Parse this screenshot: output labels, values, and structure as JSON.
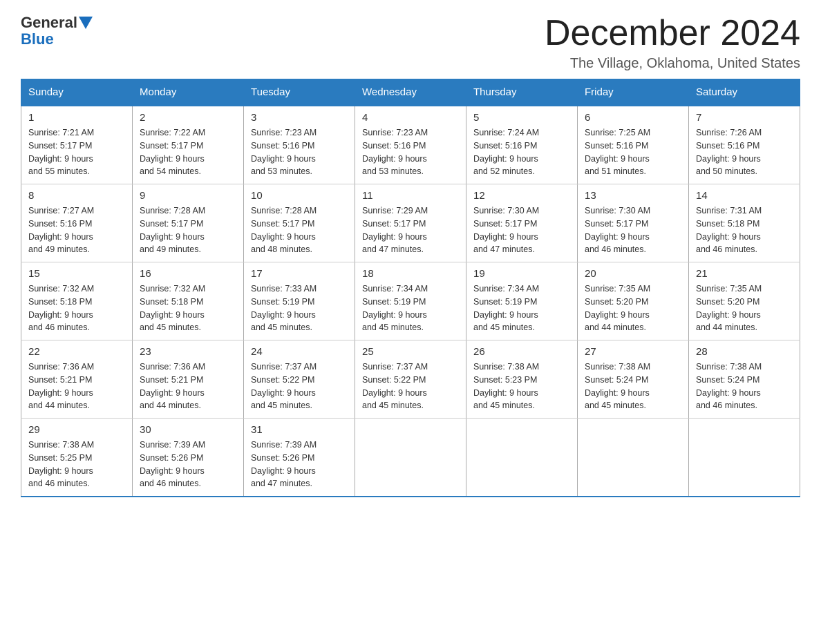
{
  "header": {
    "logo_general": "General",
    "logo_blue": "Blue",
    "month_title": "December 2024",
    "location": "The Village, Oklahoma, United States"
  },
  "columns": [
    "Sunday",
    "Monday",
    "Tuesday",
    "Wednesday",
    "Thursday",
    "Friday",
    "Saturday"
  ],
  "weeks": [
    [
      {
        "day": "1",
        "sunrise": "7:21 AM",
        "sunset": "5:17 PM",
        "daylight": "9 hours and 55 minutes."
      },
      {
        "day": "2",
        "sunrise": "7:22 AM",
        "sunset": "5:17 PM",
        "daylight": "9 hours and 54 minutes."
      },
      {
        "day": "3",
        "sunrise": "7:23 AM",
        "sunset": "5:16 PM",
        "daylight": "9 hours and 53 minutes."
      },
      {
        "day": "4",
        "sunrise": "7:23 AM",
        "sunset": "5:16 PM",
        "daylight": "9 hours and 53 minutes."
      },
      {
        "day": "5",
        "sunrise": "7:24 AM",
        "sunset": "5:16 PM",
        "daylight": "9 hours and 52 minutes."
      },
      {
        "day": "6",
        "sunrise": "7:25 AM",
        "sunset": "5:16 PM",
        "daylight": "9 hours and 51 minutes."
      },
      {
        "day": "7",
        "sunrise": "7:26 AM",
        "sunset": "5:16 PM",
        "daylight": "9 hours and 50 minutes."
      }
    ],
    [
      {
        "day": "8",
        "sunrise": "7:27 AM",
        "sunset": "5:16 PM",
        "daylight": "9 hours and 49 minutes."
      },
      {
        "day": "9",
        "sunrise": "7:28 AM",
        "sunset": "5:17 PM",
        "daylight": "9 hours and 49 minutes."
      },
      {
        "day": "10",
        "sunrise": "7:28 AM",
        "sunset": "5:17 PM",
        "daylight": "9 hours and 48 minutes."
      },
      {
        "day": "11",
        "sunrise": "7:29 AM",
        "sunset": "5:17 PM",
        "daylight": "9 hours and 47 minutes."
      },
      {
        "day": "12",
        "sunrise": "7:30 AM",
        "sunset": "5:17 PM",
        "daylight": "9 hours and 47 minutes."
      },
      {
        "day": "13",
        "sunrise": "7:30 AM",
        "sunset": "5:17 PM",
        "daylight": "9 hours and 46 minutes."
      },
      {
        "day": "14",
        "sunrise": "7:31 AM",
        "sunset": "5:18 PM",
        "daylight": "9 hours and 46 minutes."
      }
    ],
    [
      {
        "day": "15",
        "sunrise": "7:32 AM",
        "sunset": "5:18 PM",
        "daylight": "9 hours and 46 minutes."
      },
      {
        "day": "16",
        "sunrise": "7:32 AM",
        "sunset": "5:18 PM",
        "daylight": "9 hours and 45 minutes."
      },
      {
        "day": "17",
        "sunrise": "7:33 AM",
        "sunset": "5:19 PM",
        "daylight": "9 hours and 45 minutes."
      },
      {
        "day": "18",
        "sunrise": "7:34 AM",
        "sunset": "5:19 PM",
        "daylight": "9 hours and 45 minutes."
      },
      {
        "day": "19",
        "sunrise": "7:34 AM",
        "sunset": "5:19 PM",
        "daylight": "9 hours and 45 minutes."
      },
      {
        "day": "20",
        "sunrise": "7:35 AM",
        "sunset": "5:20 PM",
        "daylight": "9 hours and 44 minutes."
      },
      {
        "day": "21",
        "sunrise": "7:35 AM",
        "sunset": "5:20 PM",
        "daylight": "9 hours and 44 minutes."
      }
    ],
    [
      {
        "day": "22",
        "sunrise": "7:36 AM",
        "sunset": "5:21 PM",
        "daylight": "9 hours and 44 minutes."
      },
      {
        "day": "23",
        "sunrise": "7:36 AM",
        "sunset": "5:21 PM",
        "daylight": "9 hours and 44 minutes."
      },
      {
        "day": "24",
        "sunrise": "7:37 AM",
        "sunset": "5:22 PM",
        "daylight": "9 hours and 45 minutes."
      },
      {
        "day": "25",
        "sunrise": "7:37 AM",
        "sunset": "5:22 PM",
        "daylight": "9 hours and 45 minutes."
      },
      {
        "day": "26",
        "sunrise": "7:38 AM",
        "sunset": "5:23 PM",
        "daylight": "9 hours and 45 minutes."
      },
      {
        "day": "27",
        "sunrise": "7:38 AM",
        "sunset": "5:24 PM",
        "daylight": "9 hours and 45 minutes."
      },
      {
        "day": "28",
        "sunrise": "7:38 AM",
        "sunset": "5:24 PM",
        "daylight": "9 hours and 46 minutes."
      }
    ],
    [
      {
        "day": "29",
        "sunrise": "7:38 AM",
        "sunset": "5:25 PM",
        "daylight": "9 hours and 46 minutes."
      },
      {
        "day": "30",
        "sunrise": "7:39 AM",
        "sunset": "5:26 PM",
        "daylight": "9 hours and 46 minutes."
      },
      {
        "day": "31",
        "sunrise": "7:39 AM",
        "sunset": "5:26 PM",
        "daylight": "9 hours and 47 minutes."
      },
      {
        "day": "",
        "sunrise": "",
        "sunset": "",
        "daylight": ""
      },
      {
        "day": "",
        "sunrise": "",
        "sunset": "",
        "daylight": ""
      },
      {
        "day": "",
        "sunrise": "",
        "sunset": "",
        "daylight": ""
      },
      {
        "day": "",
        "sunrise": "",
        "sunset": "",
        "daylight": ""
      }
    ]
  ],
  "labels": {
    "sunrise": "Sunrise:",
    "sunset": "Sunset:",
    "daylight": "Daylight:"
  }
}
